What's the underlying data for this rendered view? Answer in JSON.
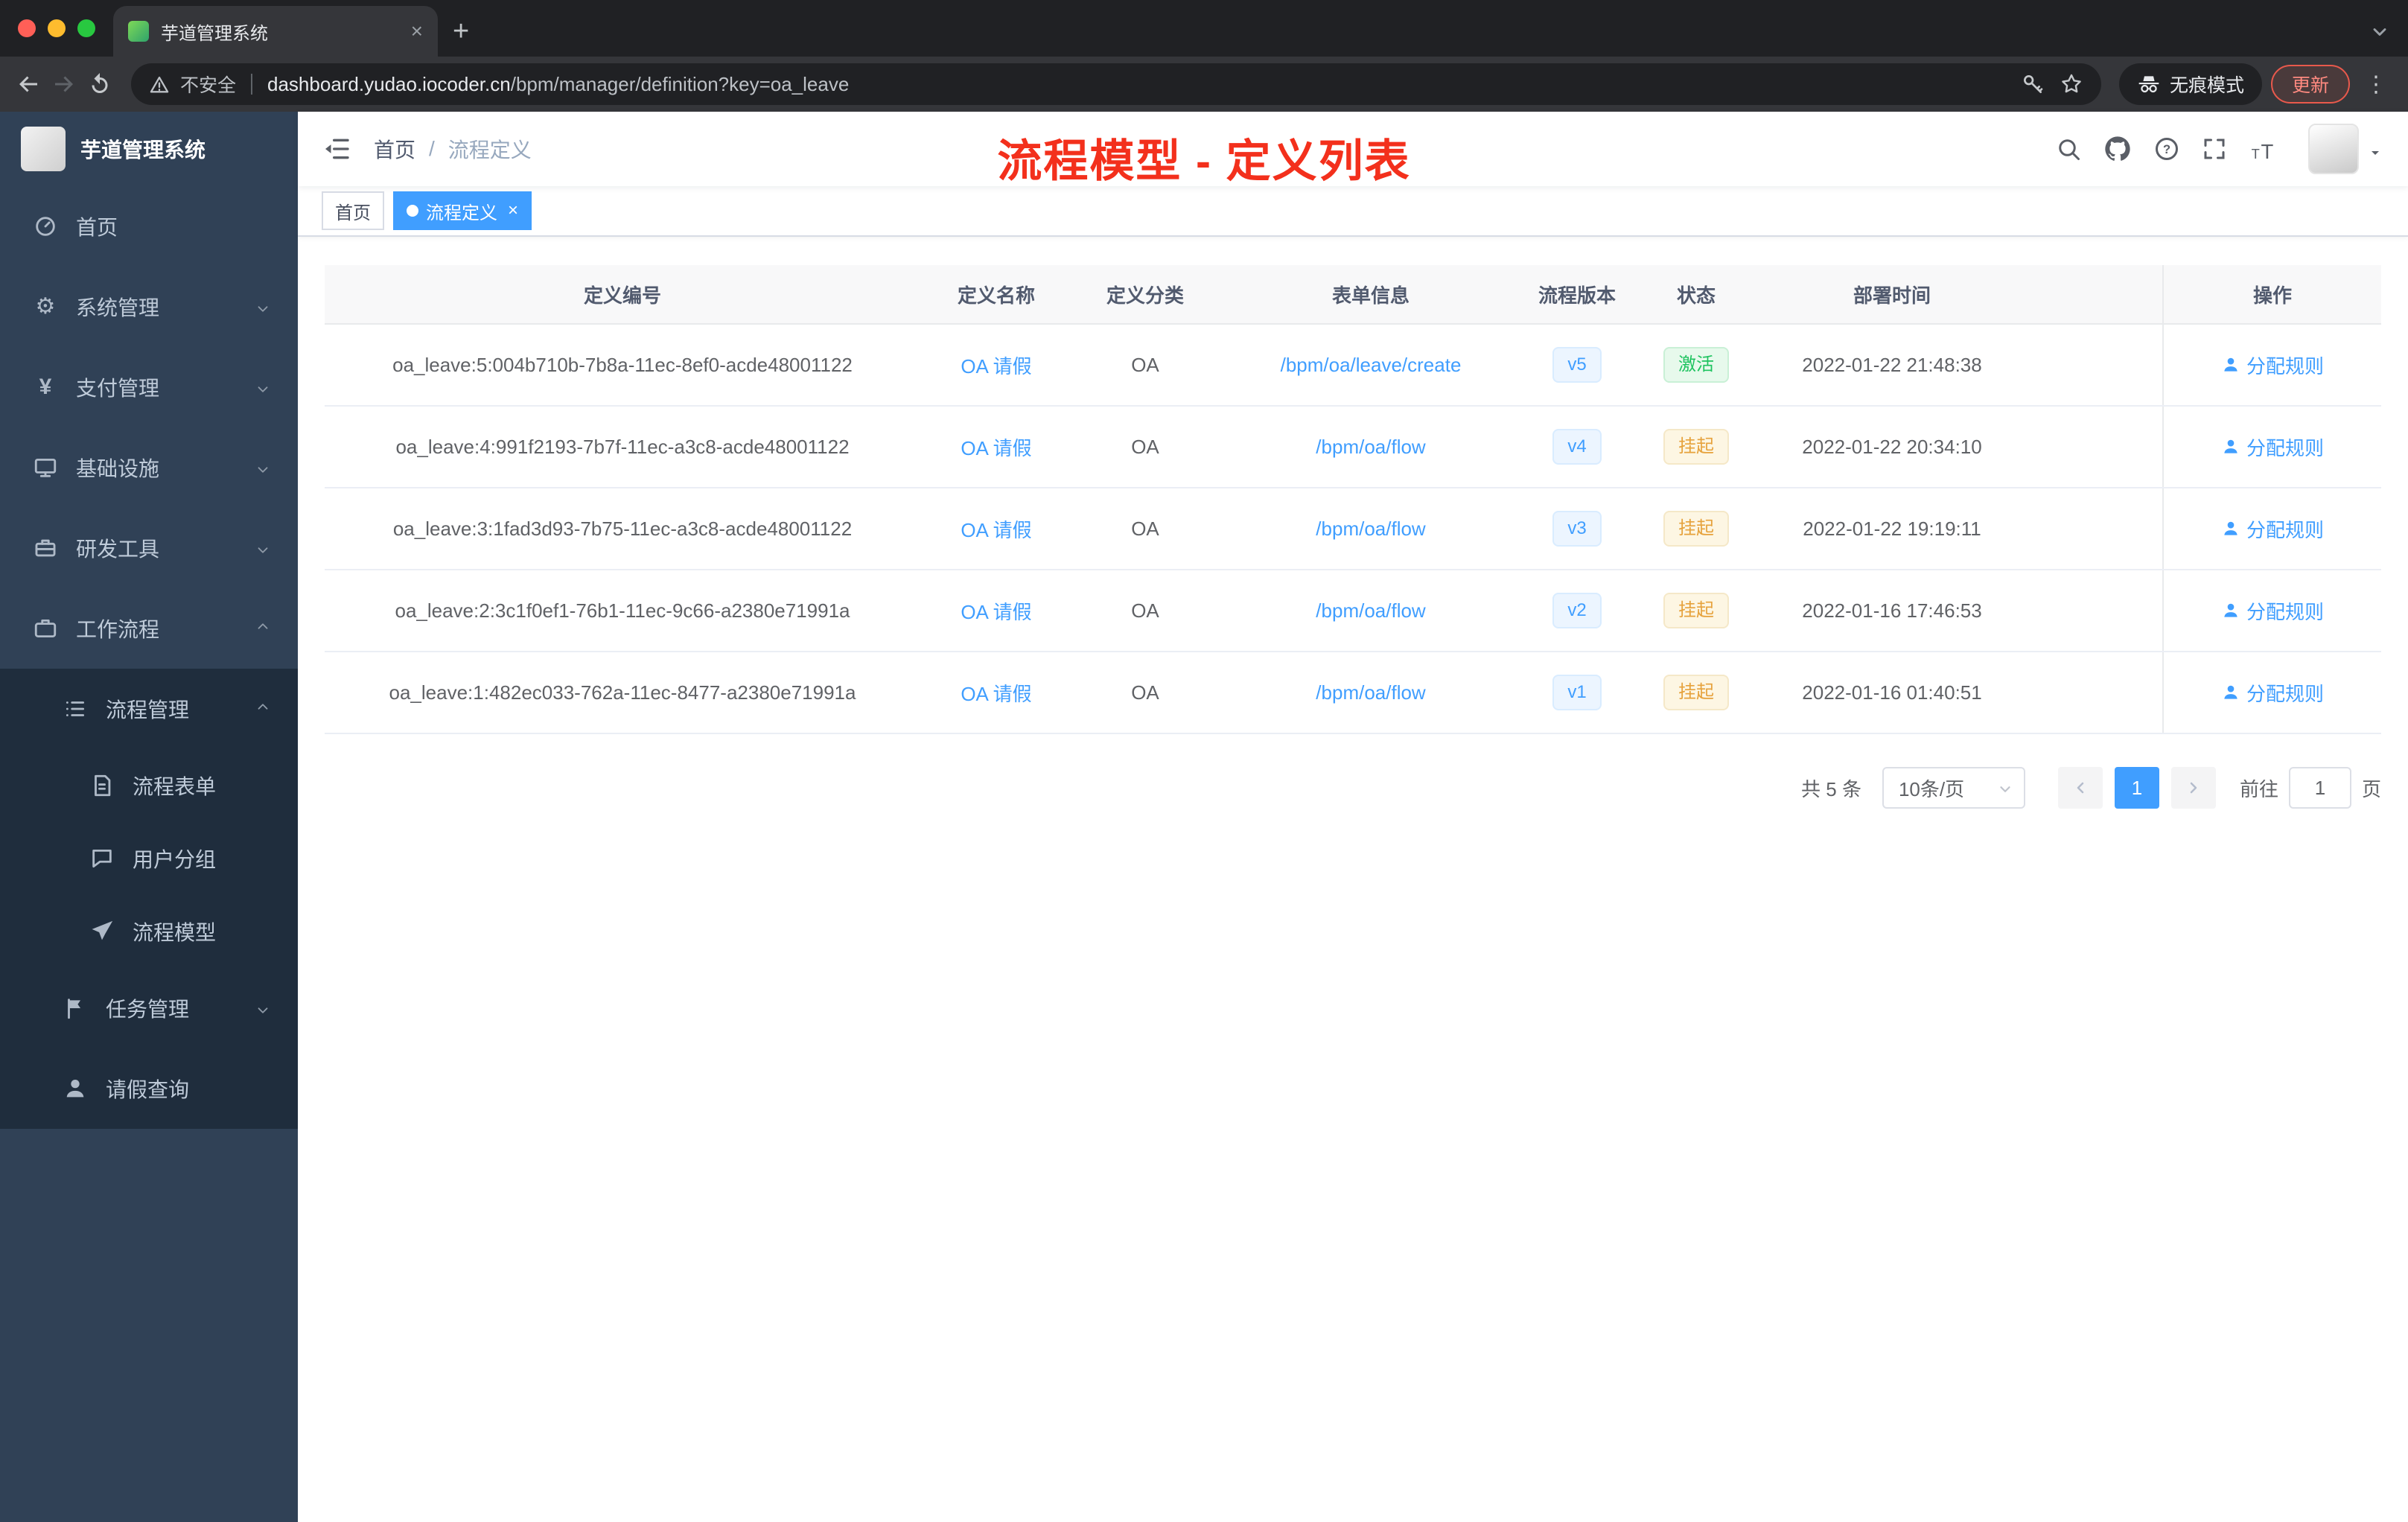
{
  "browser": {
    "tab": {
      "title": "芋道管理系统"
    },
    "security_label": "不安全",
    "url_domain": "dashboard.yudao.iocoder.cn",
    "url_path": "/bpm/manager/definition?key=oa_leave",
    "incognito_label": "无痕模式",
    "update_label": "更新"
  },
  "icons": {
    "gear": "⚙",
    "yen": "¥",
    "close": "×",
    "plus": "+",
    "kebab": "⋮"
  },
  "sidebar": {
    "logo_title": "芋道管理系统",
    "items": [
      {
        "id": "home",
        "icon": "dashboard-icon",
        "label": "首页",
        "level": 1
      },
      {
        "id": "system-management",
        "icon": "gear-icon",
        "label": "系统管理",
        "level": 1,
        "arrow": "down"
      },
      {
        "id": "payment-management",
        "icon": "yen-icon",
        "label": "支付管理",
        "level": 1,
        "arrow": "down"
      },
      {
        "id": "infrastructure",
        "icon": "monitor-icon",
        "label": "基础设施",
        "level": 1,
        "arrow": "down"
      },
      {
        "id": "dev-tools",
        "icon": "toolbox-icon",
        "label": "研发工具",
        "level": 1,
        "arrow": "down"
      },
      {
        "id": "workflow",
        "icon": "briefcase-icon",
        "label": "工作流程",
        "level": 1,
        "arrow": "up"
      },
      {
        "id": "process-management",
        "icon": "list-icon",
        "label": "流程管理",
        "level": 2,
        "arrow": "up",
        "in_group": true
      },
      {
        "id": "process-form",
        "icon": "document-icon",
        "label": "流程表单",
        "level": 3,
        "in_group": true
      },
      {
        "id": "user-group",
        "icon": "chat-icon",
        "label": "用户分组",
        "level": 3,
        "in_group": true
      },
      {
        "id": "process-model",
        "icon": "paper-plane-icon",
        "label": "流程模型",
        "level": 3,
        "in_group": true
      },
      {
        "id": "task-management",
        "icon": "flag-icon",
        "label": "任务管理",
        "level": 2,
        "arrow": "down",
        "in_group": true
      },
      {
        "id": "leave-query",
        "icon": "person-icon",
        "label": "请假查询",
        "level": 2,
        "in_group": true
      }
    ]
  },
  "header": {
    "breadcrumb": {
      "home": "首页",
      "separator": "/",
      "current": "流程定义"
    },
    "annotation": "流程模型 - 定义列表"
  },
  "tags": [
    {
      "label": "首页",
      "active": false
    },
    {
      "label": "流程定义",
      "active": true
    }
  ],
  "table": {
    "columns": [
      "定义编号",
      "定义名称",
      "定义分类",
      "表单信息",
      "流程版本",
      "状态",
      "部署时间",
      "操作"
    ],
    "action_label": "分配规则",
    "rows": [
      {
        "id": "oa_leave:5:004b710b-7b8a-11ec-8ef0-acde48001122",
        "name": "OA 请假",
        "category": "OA",
        "form": "/bpm/oa/leave/create",
        "version": "v5",
        "status": "激活",
        "status_type": "active",
        "time": "2022-01-22 21:48:38"
      },
      {
        "id": "oa_leave:4:991f2193-7b7f-11ec-a3c8-acde48001122",
        "name": "OA 请假",
        "category": "OA",
        "form": "/bpm/oa/flow",
        "version": "v4",
        "status": "挂起",
        "status_type": "suspended",
        "time": "2022-01-22 20:34:10"
      },
      {
        "id": "oa_leave:3:1fad3d93-7b75-11ec-a3c8-acde48001122",
        "name": "OA 请假",
        "category": "OA",
        "form": "/bpm/oa/flow",
        "version": "v3",
        "status": "挂起",
        "status_type": "suspended",
        "time": "2022-01-22 19:19:11"
      },
      {
        "id": "oa_leave:2:3c1f0ef1-76b1-11ec-9c66-a2380e71991a",
        "name": "OA 请假",
        "category": "OA",
        "form": "/bpm/oa/flow",
        "version": "v2",
        "status": "挂起",
        "status_type": "suspended",
        "time": "2022-01-16 17:46:53"
      },
      {
        "id": "oa_leave:1:482ec033-762a-11ec-8477-a2380e71991a",
        "name": "OA 请假",
        "category": "OA",
        "form": "/bpm/oa/flow",
        "version": "v1",
        "status": "挂起",
        "status_type": "suspended",
        "time": "2022-01-16 01:40:51"
      }
    ]
  },
  "pagination": {
    "total": "共 5 条",
    "page_size": "10条/页",
    "current_page": "1",
    "goto_label": "前往",
    "goto_value": "1",
    "page_unit": "页"
  },
  "colors": {
    "accent": "#409eff",
    "annotation_red": "#f3301c",
    "status_active": "#1ec35f",
    "status_suspended": "#e6a23c"
  }
}
